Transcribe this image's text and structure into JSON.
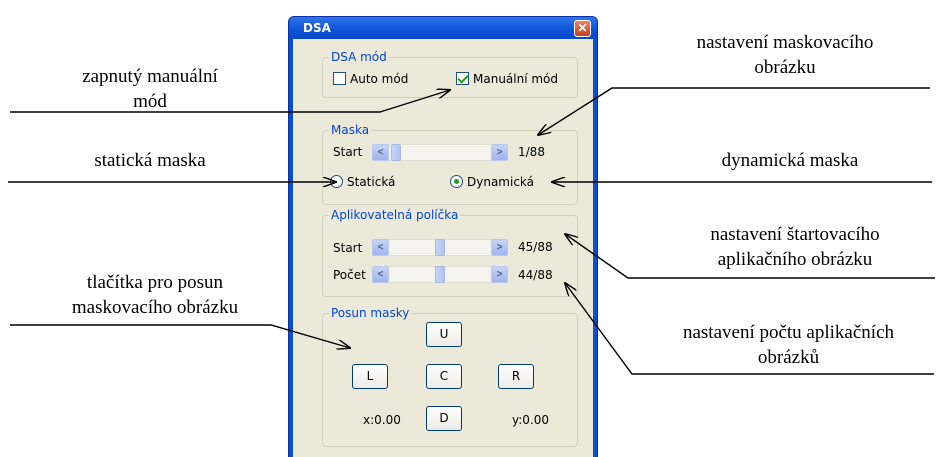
{
  "window": {
    "title": "DSA"
  },
  "dsa_mode": {
    "legend": "DSA mód",
    "auto_label": "Auto mód",
    "auto_checked": false,
    "manual_label": "Manuální mód",
    "manual_checked": true
  },
  "mask": {
    "legend": "Maska",
    "start_label": "Start",
    "start_value": "1/88",
    "static_label": "Statická",
    "dynamic_label": "Dynamická",
    "selected": "Dynamická"
  },
  "frames": {
    "legend": "Aplikovatelná políčka",
    "start_label": "Start",
    "start_value": "45/88",
    "count_label": "Počet",
    "count_value": "44/88"
  },
  "shift": {
    "legend": "Posun masky",
    "up": "U",
    "left": "L",
    "center": "C",
    "right": "R",
    "down": "D",
    "x_value": "x:0.00",
    "y_value": "y:0.00"
  },
  "annotations": {
    "manual": [
      "zapnutý manuální",
      "mód"
    ],
    "static": "statická maska",
    "buttons": [
      "tlačítka pro posun",
      "maskovacího obrázku"
    ],
    "mask_setting": [
      "nastavení maskovacího",
      "obrázku"
    ],
    "dynamic": "dynamická maska",
    "start_setting": [
      "nastavení štartovacího",
      "aplikačního obrázku"
    ],
    "count_setting": [
      "nastavení počtu aplikačních",
      "obrázků"
    ]
  }
}
